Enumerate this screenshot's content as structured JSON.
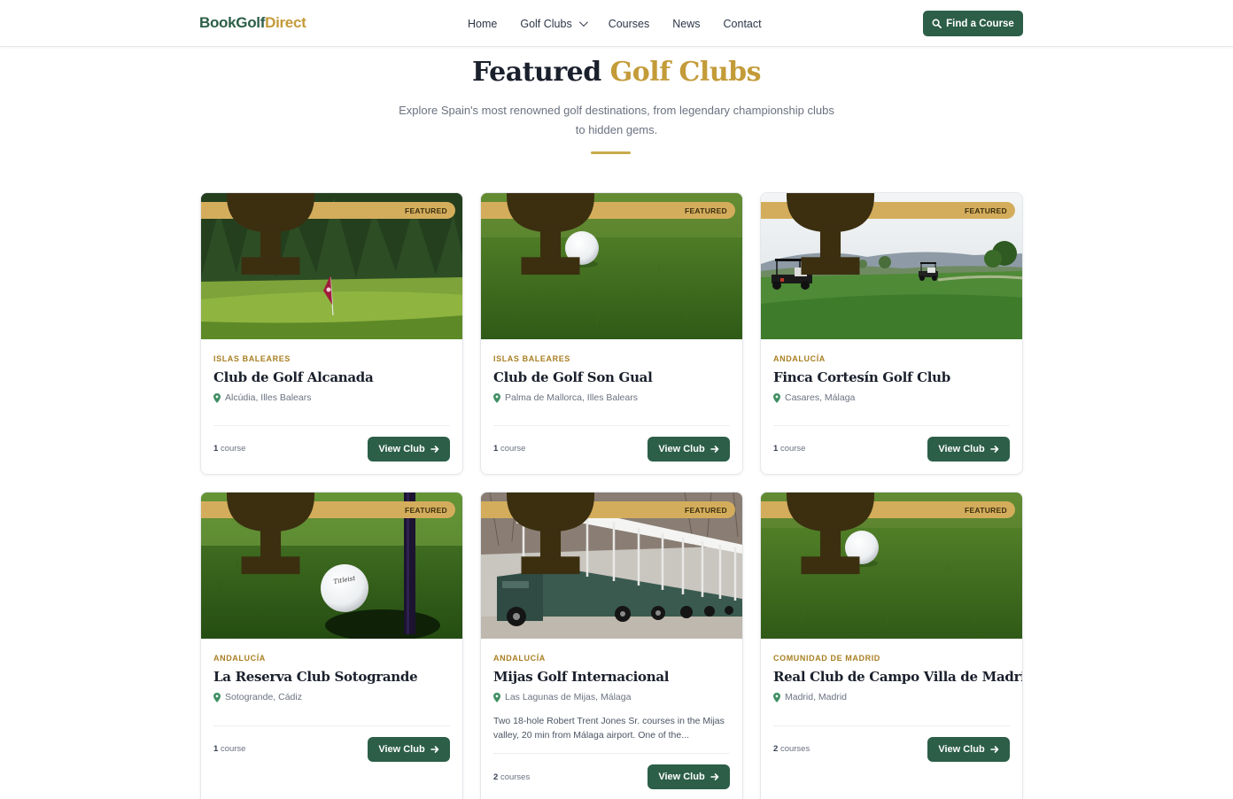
{
  "header": {
    "logo_part1": "BookGolf",
    "logo_part2": "Direct",
    "nav": [
      {
        "label": "Home"
      },
      {
        "label": "Golf Clubs",
        "has_dropdown": true
      },
      {
        "label": "Courses"
      },
      {
        "label": "News"
      },
      {
        "label": "Contact"
      }
    ],
    "cta_label": "Find a Course"
  },
  "section": {
    "title_part1": "Featured",
    "title_part2": "Golf Clubs",
    "subtitle": "Explore Spain's most renowned golf destinations, from legendary championship clubs to hidden gems."
  },
  "colors": {
    "brand_green": "#2c5e48",
    "brand_gold": "#c39b39",
    "badge_gold": "#d4ad5c"
  },
  "cards": [
    {
      "badge": "FEATURED",
      "region": "ISLAS BALEARES",
      "name": "Club de Golf Alcanada",
      "location": "Alcúdia, Illes Balears",
      "description": "",
      "count_num": "1",
      "count_label": "course",
      "button": "View Club",
      "image": "flag-on-fairway"
    },
    {
      "badge": "FEATURED",
      "region": "ISLAS BALEARES",
      "name": "Club de Golf Son Gual",
      "location": "Palma de Mallorca, Illes Balears",
      "description": "",
      "count_num": "1",
      "count_label": "course",
      "button": "View Club",
      "image": "ball-on-grass"
    },
    {
      "badge": "FEATURED",
      "region": "ANDALUCÍA",
      "name": "Finca Cortesín Golf Club",
      "location": "Casares, Málaga",
      "description": "",
      "count_num": "1",
      "count_label": "course",
      "button": "View Club",
      "image": "golf-carts-landscape"
    },
    {
      "badge": "FEATURED",
      "region": "ANDALUCÍA",
      "name": "La Reserva Club Sotogrande",
      "location": "Sotogrande, Cádiz",
      "description": "",
      "count_num": "1",
      "count_label": "course",
      "button": "View Club",
      "image": "ball-by-hole"
    },
    {
      "badge": "FEATURED",
      "region": "ANDALUCÍA",
      "name": "Mijas Golf Internacional",
      "location": "Las Lagunas de Mijas, Málaga",
      "description": "Two 18-hole Robert Trent Jones Sr. courses in the Mijas valley, 20 min from Málaga airport. One of the...",
      "count_num": "2",
      "count_label": "courses",
      "button": "View Club",
      "image": "row-of-golf-carts"
    },
    {
      "badge": "FEATURED",
      "region": "COMUNIDAD DE MADRID",
      "name": "Real Club de Campo Villa de Madrid",
      "location": "Madrid, Madrid",
      "description": "",
      "count_num": "2",
      "count_label": "courses",
      "button": "View Club",
      "image": "ball-on-grass"
    }
  ]
}
